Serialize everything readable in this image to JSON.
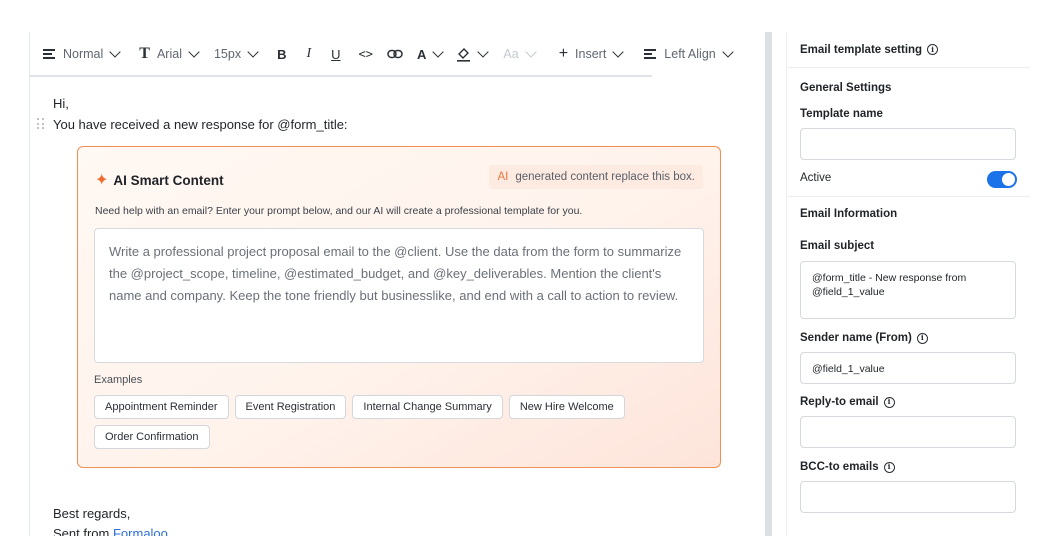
{
  "toolbar": {
    "style": "Normal",
    "font_glyph": "T",
    "font": "Arial",
    "size": "15px",
    "bold": "B",
    "italic": "I",
    "underline": "U",
    "code": "<>",
    "color_glyph": "A",
    "case": "Aa",
    "insert_plus": "+",
    "insert": "Insert",
    "align": "Left Align"
  },
  "editor": {
    "greeting": "Hi,",
    "intro_line": "You have received a new response for @form_title:",
    "closing": "Best regards,",
    "sent_from": "Sent from",
    "brand_link": "Formaloo"
  },
  "ai_box": {
    "icon": "sparkles-icon",
    "title": "AI Smart Content",
    "badge_ai": "AI",
    "badge_text": "generated content replace this box.",
    "help": "Need help with an email? Enter your prompt below, and our AI will create a professional template for you.",
    "prompt": "Write a professional project proposal email to the @client. Use the data from the form to summarize the @project_scope, timeline, @estimated_budget, and @key_deliverables. Mention the client's name and company. Keep the tone friendly but businesslike, and end with a call to action to review.",
    "examples_label": "Examples",
    "examples": [
      "Appointment Reminder",
      "Event Registration",
      "Internal Change Summary",
      "New Hire Welcome",
      "Order Confirmation"
    ],
    "accent_color": "#f28f55"
  },
  "settings": {
    "header": "Email template setting",
    "info_glyph": "i",
    "general_section": "General Settings",
    "template_name_label": "Template name",
    "template_name_value": "",
    "active_label": "Active",
    "active": true,
    "toggle_color": "#1a73e8",
    "email_info_section": "Email Information",
    "subject_label": "Email subject",
    "subject_value": "@form_title - New response from @field_1_value",
    "sender_label": "Sender name (From)",
    "sender_value": "@field_1_value",
    "reply_to_label": "Reply-to email",
    "reply_to_value": "",
    "bcc_label": "BCC-to emails",
    "bcc_value": ""
  }
}
